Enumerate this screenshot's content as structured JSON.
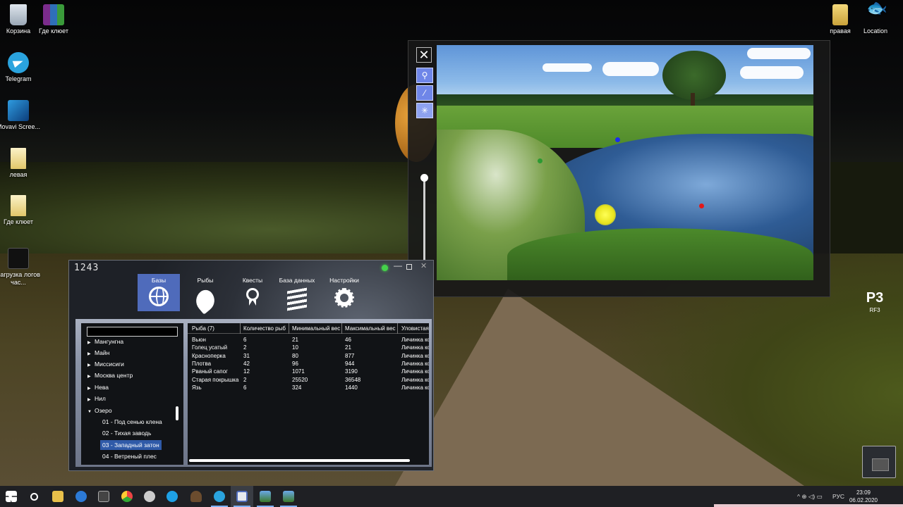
{
  "desktop": {
    "icons_left": [
      {
        "label": "Корзина",
        "icon": "recycle-bin-icon"
      },
      {
        "label": "Где клюет",
        "icon": "winrar-icon"
      },
      {
        "label": "Telegram",
        "icon": "telegram-icon"
      },
      {
        "label": "Movavi Scree...",
        "icon": "movavi-icon"
      },
      {
        "label": "левая",
        "icon": "file-icon"
      },
      {
        "label": "Где клюет",
        "icon": "file-icon"
      },
      {
        "label": "Загрузка логов час...",
        "icon": "logs-icon"
      }
    ],
    "icons_right": [
      {
        "label": "правая",
        "icon": "file-icon"
      },
      {
        "label": "Location",
        "icon": "fish-icon"
      }
    ],
    "rf3_label": "RF3",
    "rf3_glyph": "P3"
  },
  "viewer": {
    "close_glyph": "✕",
    "tools": [
      "⚲",
      "⁄",
      "✳"
    ],
    "markers": [
      "blue",
      "green",
      "red",
      "yellow"
    ]
  },
  "app": {
    "counter": "1243",
    "close_glyph": "✕",
    "min_glyph": "—",
    "tabs": [
      {
        "label": "Базы",
        "icon": "globe-icon"
      },
      {
        "label": "Рыбы",
        "icon": "fish-icon"
      },
      {
        "label": "Квесты",
        "icon": "medal-icon"
      },
      {
        "label": "База данных",
        "icon": "layers-icon"
      },
      {
        "label": "Настройки",
        "icon": "gear-icon"
      }
    ],
    "search_value": "",
    "tree": [
      {
        "label": "Мангунгна",
        "arrow": "▶"
      },
      {
        "label": "Майн",
        "arrow": "▶"
      },
      {
        "label": "Миссисиги",
        "arrow": "▶"
      },
      {
        "label": "Москва центр",
        "arrow": "▶"
      },
      {
        "label": "Нева",
        "arrow": "▶"
      },
      {
        "label": "Нил",
        "arrow": "▶"
      },
      {
        "label": "Озеро",
        "arrow": "▼"
      }
    ],
    "tree_children": [
      "01 - Под сенью клена",
      "02 - Тихая заводь",
      "03 - Западный затон",
      "04 - Ветреный плес"
    ],
    "columns": [
      "Рыба (7)",
      "Количество рыб",
      "Минимальный вес",
      "Максимальный вес",
      "Уловистая"
    ],
    "rows": [
      [
        "Вьюн",
        "6",
        "21",
        "46",
        "Личинка кор"
      ],
      [
        "Голец усатый",
        "2",
        "10",
        "21",
        "Личинка кор"
      ],
      [
        "Красноперка",
        "31",
        "80",
        "877",
        "Личинка кор"
      ],
      [
        "Плотва",
        "42",
        "96",
        "944",
        "Личинка кор"
      ],
      [
        "Рваный сапог",
        "12",
        "1071",
        "3190",
        "Личинка кор"
      ],
      [
        "Старая покрышка",
        "2",
        "25520",
        "36548",
        "Личинка кор"
      ],
      [
        "Язь",
        "6",
        "324",
        "1440",
        "Личинка кор"
      ]
    ]
  },
  "taskbar": {
    "apps": [
      "start-icon",
      "search-icon",
      "explorer-icon",
      "edge-icon",
      "calculator-icon",
      "chrome-icon",
      "webcam-icon",
      "skype-icon",
      "user-icon",
      "telegram-icon",
      "app-icon",
      "image-icon",
      "image-icon"
    ],
    "tray_lang": "РУС",
    "time": "23:09",
    "date": "06.02.2020",
    "tray_glyphs": "^ ⊕ ◁) ▭"
  },
  "colors": {
    "accent": "#4f6bbb",
    "selected": "#2f5aa8",
    "tool_blue": "#6f86e8"
  }
}
